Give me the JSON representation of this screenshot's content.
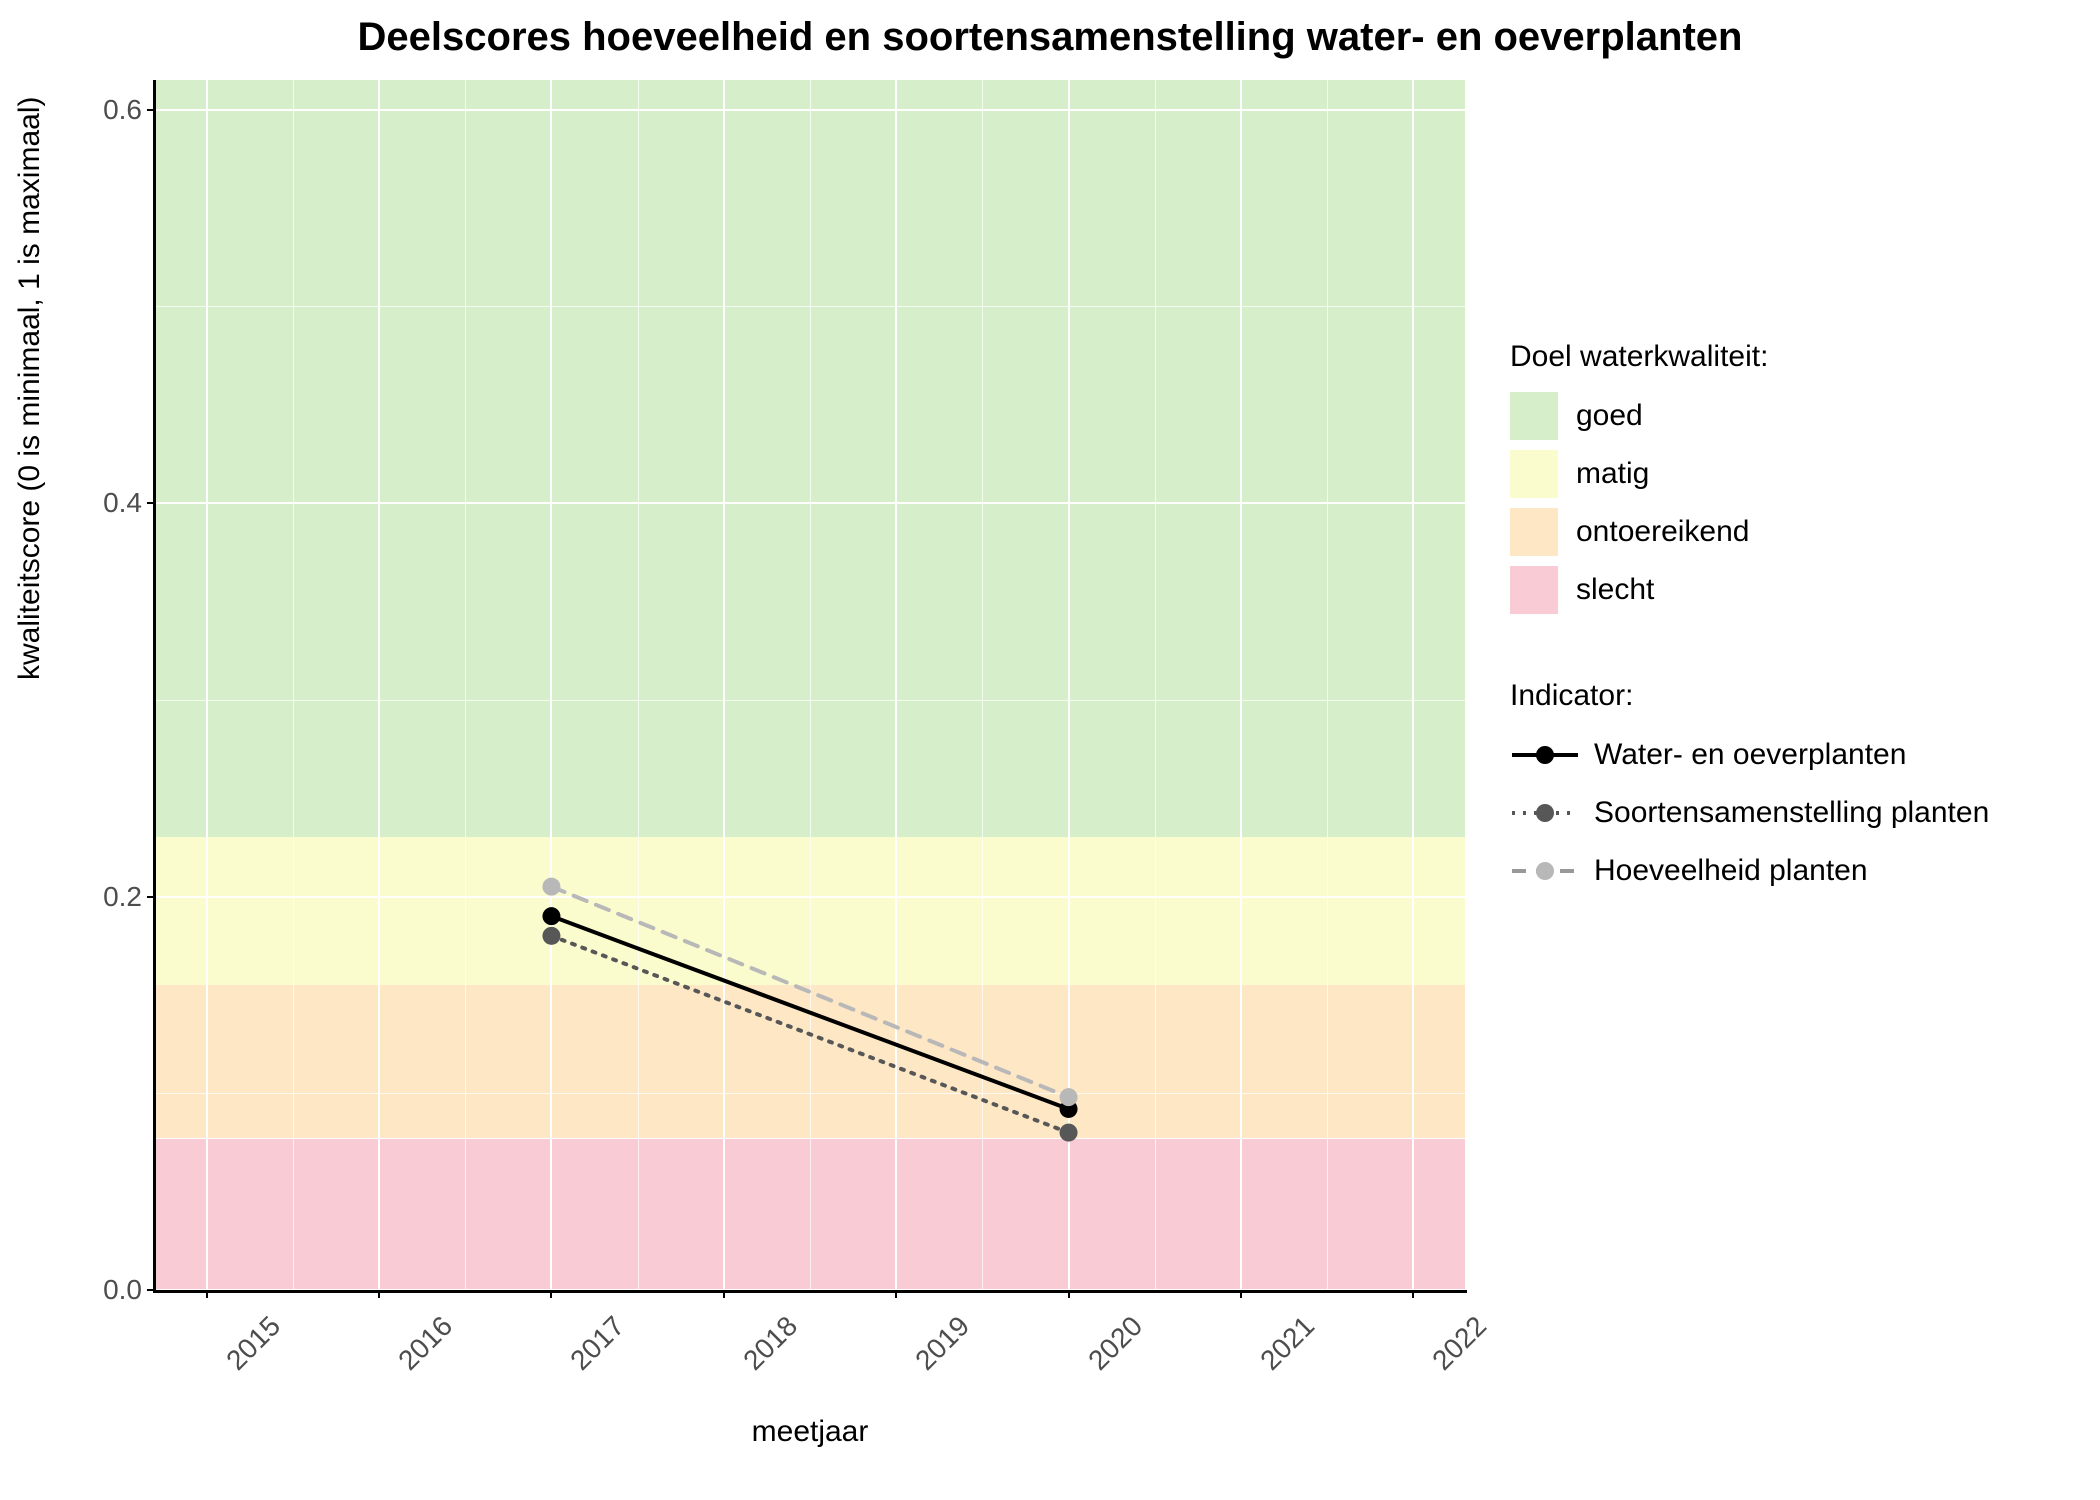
{
  "title": "Deelscores hoeveelheid en soortensamenstelling water- en oeverplanten",
  "xlabel": "meetjaar",
  "ylabel": "kwaliteitscore (0 is minimaal, 1 is maximaal)",
  "legend_bands_title": "Doel waterkwaliteit:",
  "legend_series_title": "Indicator:",
  "x_ticks": [
    "2015",
    "2016",
    "2017",
    "2018",
    "2019",
    "2020",
    "2021",
    "2022"
  ],
  "y_ticks": [
    "0.0",
    "0.2",
    "0.4",
    "0.6"
  ],
  "bands": [
    {
      "label": "goed",
      "color": "#d7eecb",
      "from": 0.23,
      "to": 0.615
    },
    {
      "label": "matig",
      "color": "#fbfcce",
      "from": 0.155,
      "to": 0.23
    },
    {
      "label": "ontoereikend",
      "color": "#fde7c5",
      "from": 0.077,
      "to": 0.155
    },
    {
      "label": "slecht",
      "color": "#f9ccd5",
      "from": 0.0,
      "to": 0.077
    }
  ],
  "series": [
    {
      "label": "Water- en oeverplanten",
      "color": "#000000",
      "dash": "solid",
      "marker": "#000000"
    },
    {
      "label": "Soortensamenstelling planten",
      "color": "#575757",
      "dash": "dotted",
      "marker": "#575757"
    },
    {
      "label": "Hoeveelheid planten",
      "color": "#b8b8b8",
      "dash": "dashed",
      "marker": "#b8b8b8"
    }
  ],
  "chart_data": {
    "type": "line",
    "title": "Deelscores hoeveelheid en soortensamenstelling water- en oeverplanten",
    "xlabel": "meetjaar",
    "ylabel": "kwaliteitscore (0 is minimaal, 1 is maximaal)",
    "xlim": [
      2014.7,
      2022.3
    ],
    "ylim": [
      0.0,
      0.615
    ],
    "x_ticks": [
      2015,
      2016,
      2017,
      2018,
      2019,
      2020,
      2021,
      2022
    ],
    "y_ticks": [
      0.0,
      0.2,
      0.4,
      0.6
    ],
    "background_bands": [
      {
        "name": "goed",
        "ymin": 0.23,
        "ymax": 0.615,
        "color": "#d7eecb"
      },
      {
        "name": "matig",
        "ymin": 0.155,
        "ymax": 0.23,
        "color": "#fbfcce"
      },
      {
        "name": "ontoereikend",
        "ymin": 0.077,
        "ymax": 0.155,
        "color": "#fde7c5"
      },
      {
        "name": "slecht",
        "ymin": 0.0,
        "ymax": 0.077,
        "color": "#f9ccd5"
      }
    ],
    "series": [
      {
        "name": "Water- en oeverplanten",
        "linestyle": "solid",
        "color": "#000000",
        "x": [
          2017,
          2020
        ],
        "y": [
          0.19,
          0.092
        ]
      },
      {
        "name": "Soortensamenstelling planten",
        "linestyle": "dotted",
        "color": "#575757",
        "x": [
          2017,
          2020
        ],
        "y": [
          0.18,
          0.08
        ]
      },
      {
        "name": "Hoeveelheid planten",
        "linestyle": "dashed",
        "color": "#b8b8b8",
        "x": [
          2017,
          2020
        ],
        "y": [
          0.205,
          0.098
        ]
      }
    ],
    "legend_position": "right"
  }
}
